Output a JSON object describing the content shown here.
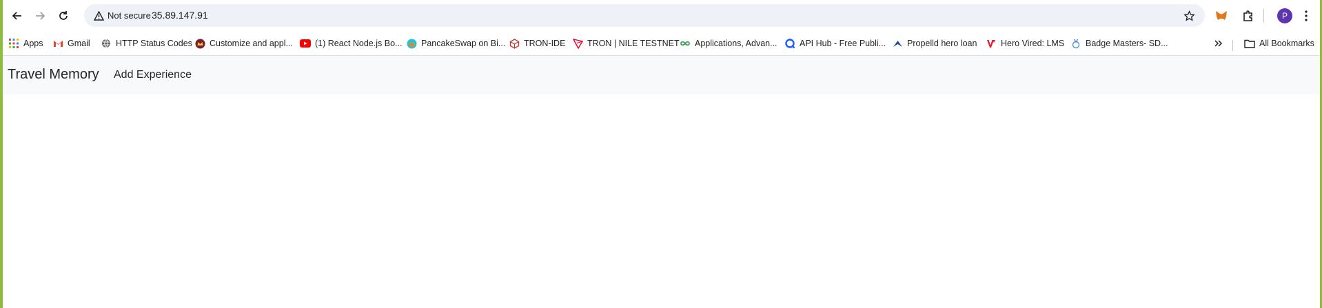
{
  "browser": {
    "security_label": "Not secure",
    "url": "35.89.147.91",
    "profile_initial": "P",
    "bookmarks": [
      {
        "label": "Apps",
        "icon": "apps-grid-icon"
      },
      {
        "label": "Gmail",
        "icon": "gmail-icon"
      },
      {
        "label": "HTTP Status Codes",
        "icon": "globe-icon"
      },
      {
        "label": "Customize and appl...",
        "icon": "crown-icon"
      },
      {
        "label": "(1) React Node.js Bo...",
        "icon": "youtube-icon"
      },
      {
        "label": "PancakeSwap on Bi...",
        "icon": "pancakeswap-icon"
      },
      {
        "label": "TRON-IDE",
        "icon": "tron-ide-icon"
      },
      {
        "label": "TRON | NILE TESTNET",
        "icon": "tron-icon"
      },
      {
        "label": "Applications, Advan...",
        "icon": "infinity-icon"
      },
      {
        "label": "API Hub - Free Publi...",
        "icon": "api-hub-icon"
      },
      {
        "label": "Propelld hero loan",
        "icon": "propelld-icon"
      },
      {
        "label": "Hero Vired: LMS",
        "icon": "hero-vired-icon"
      },
      {
        "label": "Badge Masters- SD...",
        "icon": "badge-icon"
      }
    ],
    "all_bookmarks_label": "All Bookmarks"
  },
  "app": {
    "brand": "Travel Memory",
    "nav_link": "Add Experience"
  },
  "colors": {
    "frame": "#8fbc3f",
    "navbar_bg": "#f8f9fa",
    "omnibox_bg": "#eef1f7",
    "profile": "#5e35b1"
  }
}
